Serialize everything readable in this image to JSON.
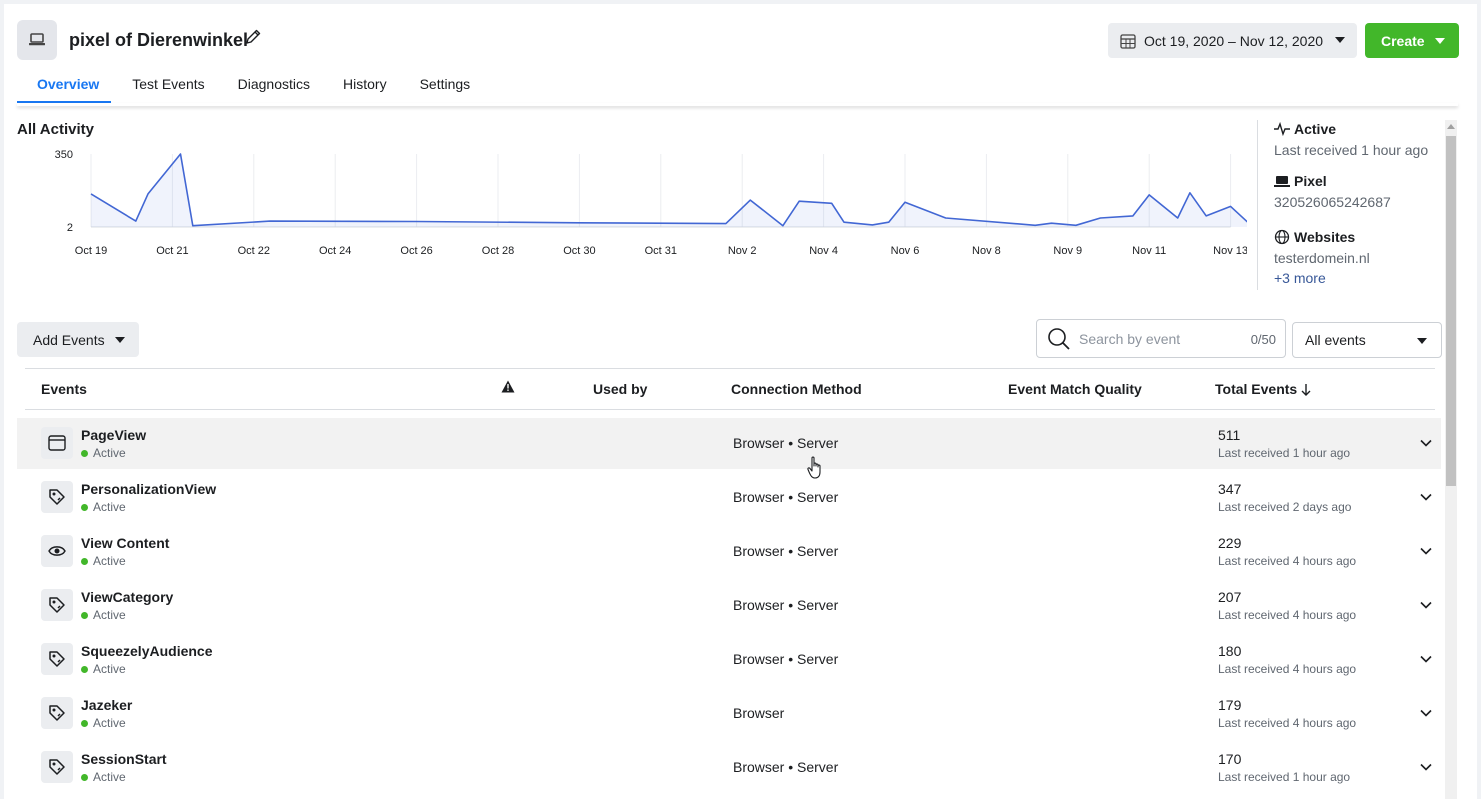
{
  "header": {
    "title": "pixel of Dierenwinkel",
    "date_range": "Oct 19, 2020 – Nov 12, 2020",
    "create_label": "Create"
  },
  "tabs": [
    {
      "label": "Overview",
      "active": true
    },
    {
      "label": "Test Events"
    },
    {
      "label": "Diagnostics"
    },
    {
      "label": "History"
    },
    {
      "label": "Settings"
    }
  ],
  "activity": {
    "title": "All Activity"
  },
  "chart_data": {
    "type": "area",
    "ylim": [
      2,
      350
    ],
    "y_ticks": [
      "350",
      "2"
    ],
    "x_ticks": [
      "Oct 19",
      "Oct 21",
      "Oct 22",
      "Oct 24",
      "Oct 26",
      "Oct 28",
      "Oct 30",
      "Oct 31",
      "Nov 2",
      "Nov 4",
      "Nov 6",
      "Nov 8",
      "Nov 9",
      "Nov 11",
      "Nov 13"
    ],
    "series": [
      {
        "color": "#4267d4",
        "points": [
          [
            0,
            160
          ],
          [
            0.55,
            30
          ],
          [
            0.7,
            160
          ],
          [
            1.1,
            350
          ],
          [
            1.25,
            8
          ],
          [
            2.2,
            30
          ],
          [
            4,
            28
          ],
          [
            6,
            22
          ],
          [
            7.8,
            18
          ],
          [
            8.1,
            130
          ],
          [
            8.5,
            8
          ],
          [
            8.7,
            125
          ],
          [
            9.1,
            115
          ],
          [
            9.25,
            25
          ],
          [
            9.6,
            12
          ],
          [
            9.8,
            25
          ],
          [
            10,
            120
          ],
          [
            10.5,
            45
          ],
          [
            11.6,
            10
          ],
          [
            11.8,
            20
          ],
          [
            12.1,
            10
          ],
          [
            12.4,
            45
          ],
          [
            12.8,
            55
          ],
          [
            13,
            155
          ],
          [
            13.35,
            45
          ],
          [
            13.5,
            165
          ],
          [
            13.7,
            55
          ],
          [
            14,
            100
          ],
          [
            14.25,
            10
          ]
        ]
      }
    ]
  },
  "info": {
    "status_label": "Active",
    "status_detail": "Last received 1 hour ago",
    "pixel_label": "Pixel",
    "pixel_id": "320526065242687",
    "websites_label": "Websites",
    "website": "testerdomein.nl",
    "more": "+3 more"
  },
  "controls": {
    "add_events": "Add Events",
    "search_placeholder": "Search by event",
    "search_count": "0/50",
    "filter": "All events"
  },
  "table": {
    "headers": {
      "events": "Events",
      "used_by": "Used by",
      "connection": "Connection Method",
      "emq": "Event Match Quality",
      "total": "Total Events"
    },
    "rows": [
      {
        "name": "PageView",
        "status": "Active",
        "connection": "Browser • Server",
        "total": "511",
        "received": "Last received 1 hour ago",
        "icon": "browser-window-icon"
      },
      {
        "name": "PersonalizationView",
        "status": "Active",
        "connection": "Browser • Server",
        "total": "347",
        "received": "Last received 2 days ago",
        "icon": "tag-icon"
      },
      {
        "name": "View Content",
        "status": "Active",
        "connection": "Browser • Server",
        "total": "229",
        "received": "Last received 4 hours ago",
        "icon": "eye-icon"
      },
      {
        "name": "ViewCategory",
        "status": "Active",
        "connection": "Browser • Server",
        "total": "207",
        "received": "Last received 4 hours ago",
        "icon": "tag-icon"
      },
      {
        "name": "SqueezelyAudience",
        "status": "Active",
        "connection": "Browser • Server",
        "total": "180",
        "received": "Last received 4 hours ago",
        "icon": "tag-icon"
      },
      {
        "name": "Jazeker",
        "status": "Active",
        "connection": "Browser",
        "total": "179",
        "received": "Last received 4 hours ago",
        "icon": "tag-icon"
      },
      {
        "name": "SessionStart",
        "status": "Active",
        "connection": "Browser • Server",
        "total": "170",
        "received": "Last received 1 hour ago",
        "icon": "tag-icon"
      }
    ]
  }
}
